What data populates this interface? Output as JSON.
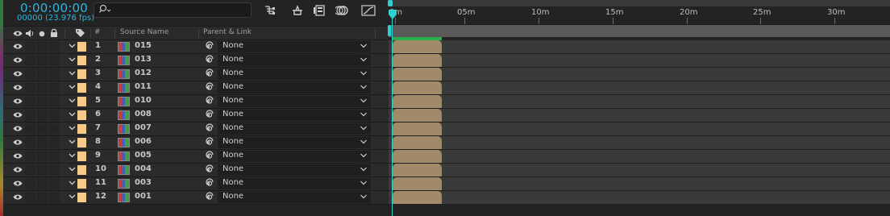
{
  "timecode": "0:00:00:00",
  "frame_info": "00000 (23.976 fps)",
  "search": {
    "placeholder": ""
  },
  "toolbar_icons": [
    "draft-3d-icon",
    "shy-icon",
    "frame-blend-icon",
    "motion-blur-icon",
    "graph-editor-icon"
  ],
  "columns": {
    "number": "#",
    "source_name": "Source Name",
    "parent_link": "Parent & Link"
  },
  "ruler": {
    "ticks": [
      "0m",
      "05m",
      "10m",
      "15m",
      "20m",
      "25m",
      "30m"
    ]
  },
  "layers": [
    {
      "num": "1",
      "source": "015",
      "parent": "None"
    },
    {
      "num": "2",
      "source": "013",
      "parent": "None"
    },
    {
      "num": "3",
      "source": "012",
      "parent": "None"
    },
    {
      "num": "4",
      "source": "011",
      "parent": "None"
    },
    {
      "num": "5",
      "source": "010",
      "parent": "None"
    },
    {
      "num": "6",
      "source": "008",
      "parent": "None"
    },
    {
      "num": "7",
      "source": "007",
      "parent": "None"
    },
    {
      "num": "8",
      "source": "006",
      "parent": "None"
    },
    {
      "num": "9",
      "source": "005",
      "parent": "None"
    },
    {
      "num": "10",
      "source": "004",
      "parent": "None"
    },
    {
      "num": "11",
      "source": "003",
      "parent": "None"
    },
    {
      "num": "12",
      "source": "001",
      "parent": "None"
    }
  ],
  "colors": {
    "timecode": "#2fb4e0",
    "label": "#f7c98a",
    "clip": "#a08a68",
    "cti": "#2fd0d0",
    "work_area": "#2aad4a"
  }
}
